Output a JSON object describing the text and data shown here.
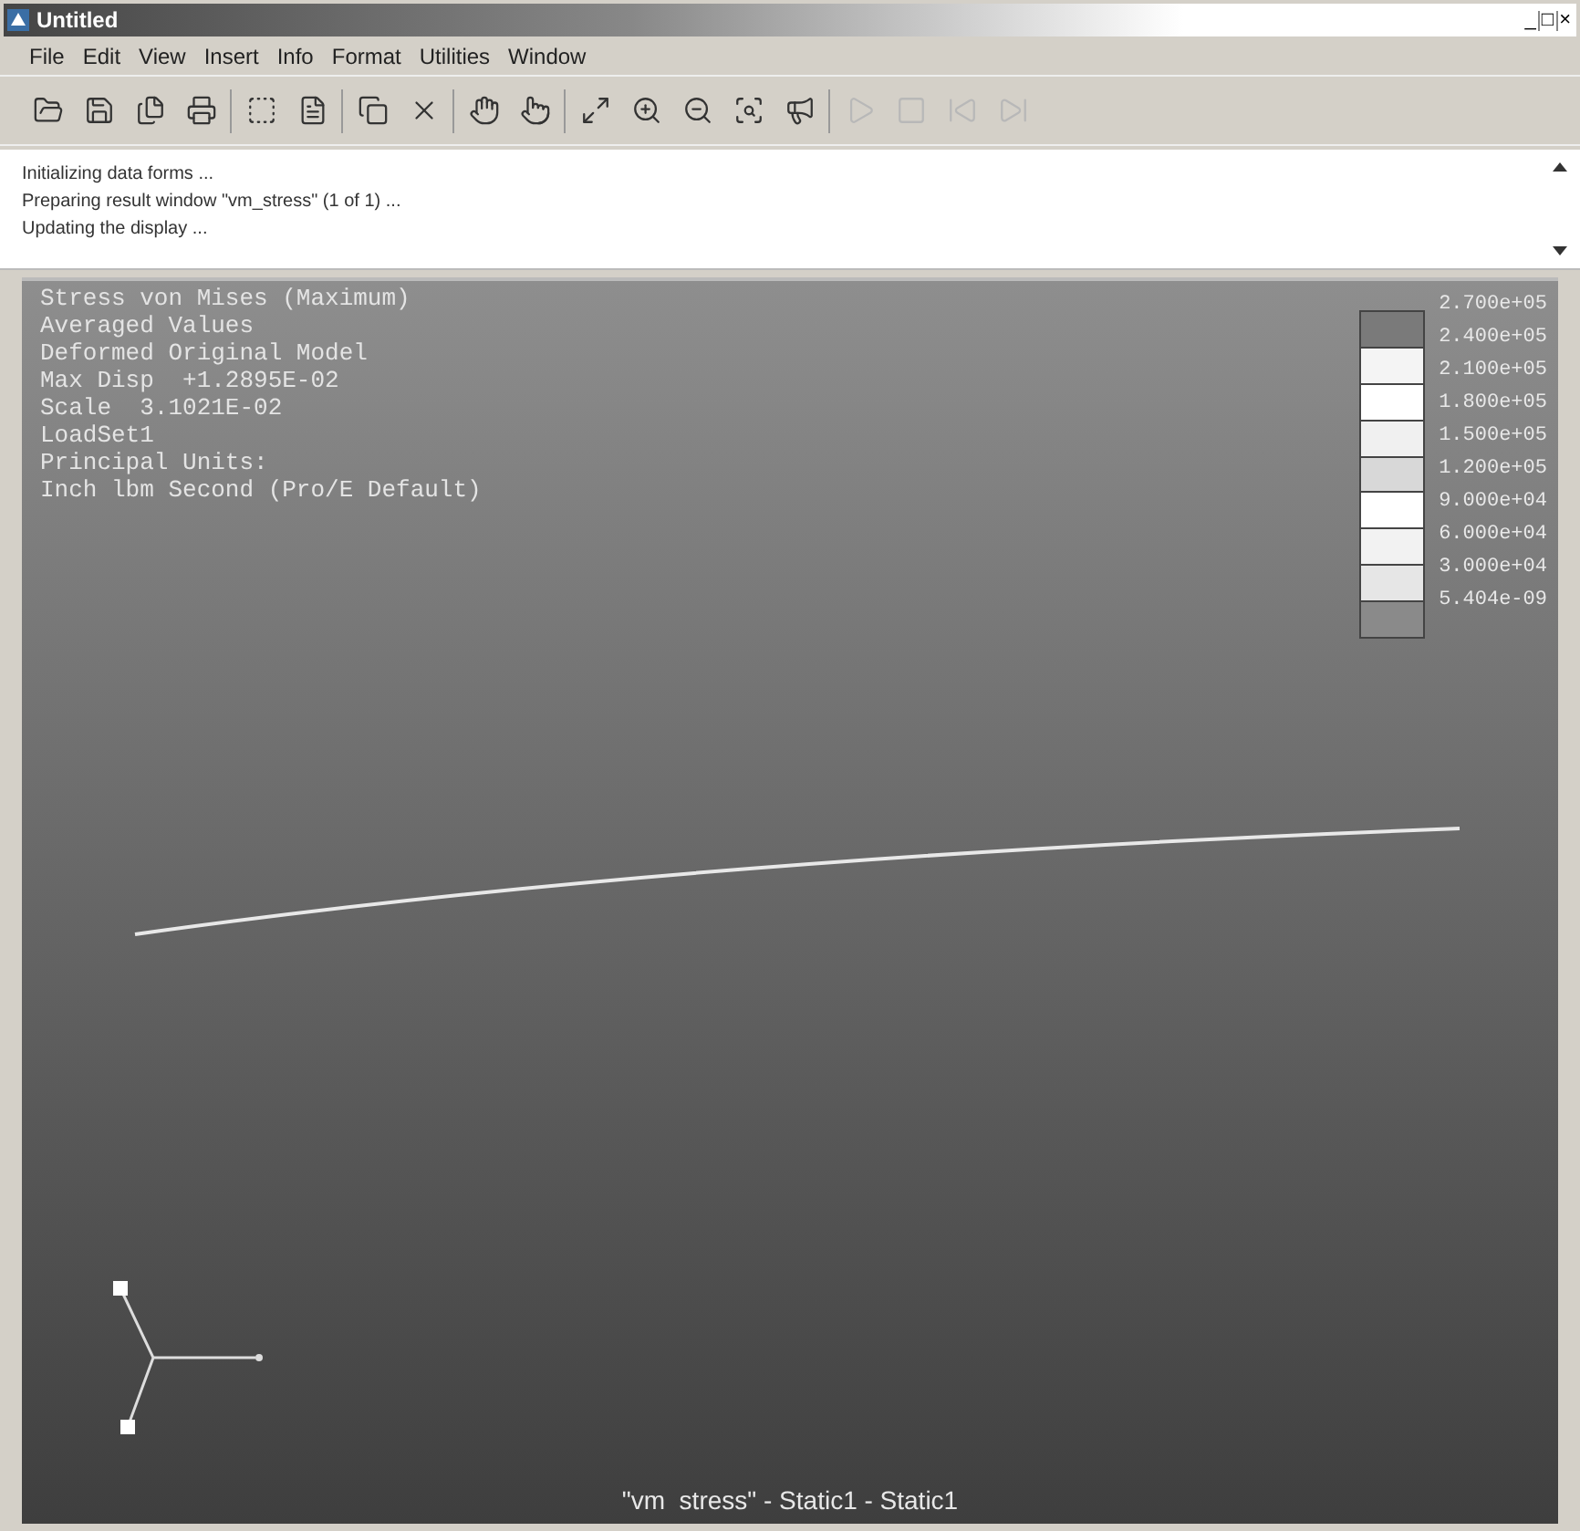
{
  "window": {
    "title": "Untitled",
    "controls": [
      "_",
      "□",
      "×"
    ]
  },
  "menu": [
    "File",
    "Edit",
    "View",
    "Insert",
    "Info",
    "Format",
    "Utilities",
    "Window"
  ],
  "toolbar": {
    "groups": [
      [
        {
          "disabled": false
        },
        {
          "disabled": false
        },
        {
          "disabled": false
        },
        {
          "disabled": false
        }
      ],
      [
        {
          "disabled": false
        },
        {
          "disabled": false
        }
      ],
      [
        {
          "disabled": false
        },
        {
          "disabled": false
        }
      ],
      [
        {
          "disabled": false
        },
        {
          "disabled": false
        }
      ],
      [
        {
          "disabled": false
        },
        {
          "disabled": false
        },
        {
          "disabled": false
        },
        {
          "disabled": false
        },
        {
          "disabled": false
        }
      ],
      [
        {
          "disabled": true
        },
        {
          "disabled": true
        },
        {
          "disabled": true
        },
        {
          "disabled": true
        }
      ]
    ]
  },
  "messages": [
    "Initializing data forms ...",
    "Preparing result window \"vm_stress\" (1 of 1) ...",
    "Updating the display ..."
  ],
  "viewport": {
    "info": [
      "Stress von Mises (Maximum)",
      "Averaged Values",
      "Deformed Original Model",
      "Max Disp  +1.2895E-02",
      "Scale  3.1021E-02",
      "LoadSet1",
      "Principal Units:",
      "Inch lbm Second (Pro/E Default)"
    ],
    "legend": [
      "2.700e+05",
      "2.400e+05",
      "2.100e+05",
      "1.800e+05",
      "1.500e+05",
      "1.200e+05",
      "9.000e+04",
      "6.000e+04",
      "3.000e+04",
      "5.404e-09"
    ],
    "caption": "\"vm  stress\" - Static1 - Static1"
  }
}
